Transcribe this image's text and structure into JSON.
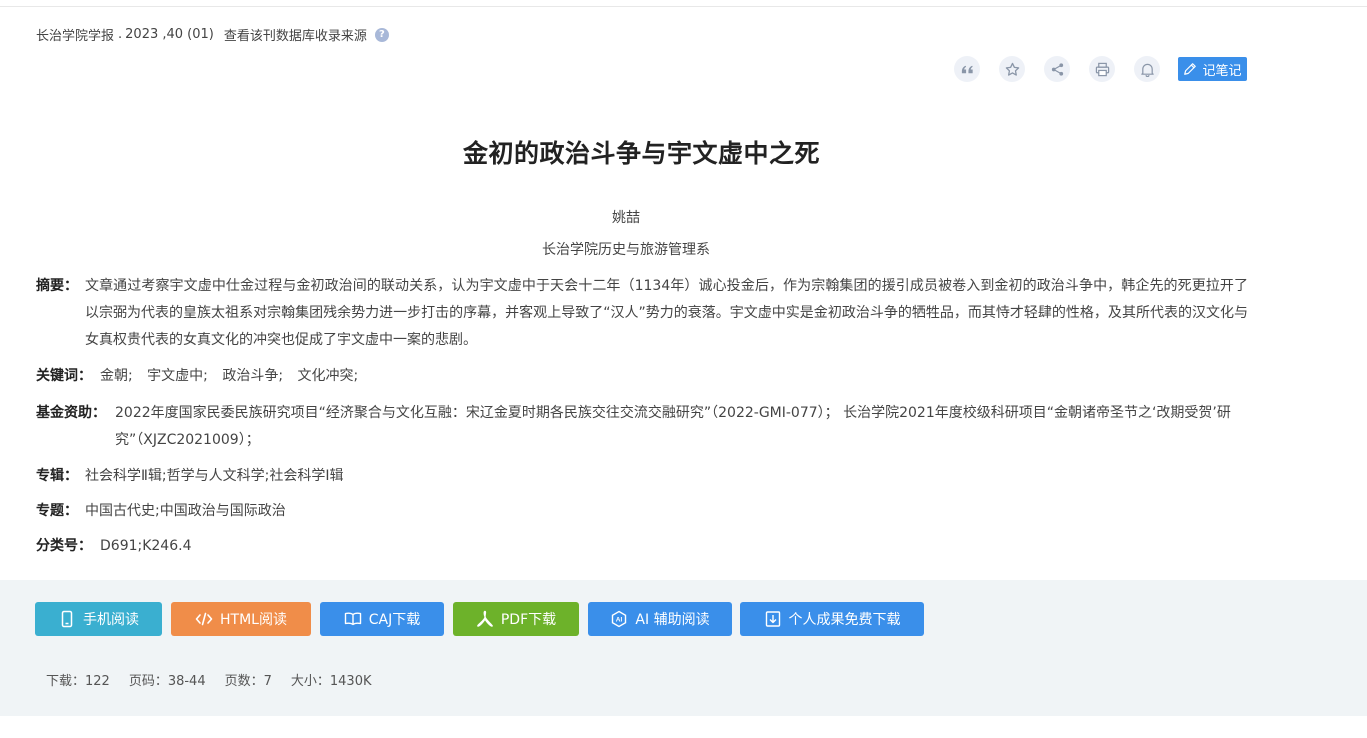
{
  "source": {
    "journal": "长治学院学报",
    "sep": ".",
    "issue": "2023 ,40 (01)",
    "db_link": "查看该刊数据库收录来源",
    "help_icon": "?"
  },
  "toolbar": {
    "icons": [
      "quote-icon",
      "star-icon",
      "share-icon",
      "print-icon",
      "bell-icon"
    ],
    "note_label": "记笔记"
  },
  "article": {
    "title": "金初的政治斗争与宇文虚中之死",
    "author": "姚喆",
    "affiliation": "长治学院历史与旅游管理系"
  },
  "meta": {
    "abstract_label": "摘要：",
    "abstract": "文章通过考察宇文虚中仕金过程与金初政治间的联动关系，认为宇文虚中于天会十二年（1134年）诚心投金后，作为宗翰集团的援引成员被卷入到金初的政治斗争中，韩企先的死更拉开了以宗弼为代表的皇族太祖系对宗翰集团残余势力进一步打击的序幕，并客观上导致了“汉人”势力的衰落。宇文虚中实是金初政治斗争的牺牲品，而其恃才轻肆的性格，及其所代表的汉文化与女真权贵代表的女真文化的冲突也促成了宇文虚中一案的悲剧。",
    "keywords_label": "关键词：",
    "keywords": [
      "金朝;",
      "宇文虚中;",
      "政治斗争;",
      "文化冲突;"
    ],
    "funds_label": "基金资助：",
    "funds": "2022年度国家民委民族研究项目“经济聚合与文化互融：宋辽金夏时期各民族交往交流交融研究”（2022-GMI-077）；  长治学院2021年度校级科研项目“金朝诸帝圣节之‘改期受贺’研究”（XJZC2021009）；",
    "zhuanji_label": "专辑：",
    "zhuanji": "社会科学Ⅱ辑;哲学与人文科学;社会科学Ⅰ辑",
    "zhuanti_label": "专题：",
    "zhuanti": "中国古代史;中国政治与国际政治",
    "clc_label": "分类号：",
    "clc": "D691;K246.4"
  },
  "actions": {
    "mobile": "手机阅读",
    "html": "HTML阅读",
    "caj": "CAJ下载",
    "pdf": "PDF下载",
    "ai": "AI 辅助阅读",
    "personal": "个人成果免费下载"
  },
  "stats": {
    "downloads": "下载：122",
    "pages_range": "页码：38-44",
    "page_count": "页数：7",
    "size": "大小：1430K"
  },
  "colors": {
    "accent_blue": "#3a8fea",
    "mobile_btn": "#3aafd0",
    "html_btn": "#f08d49",
    "pdf_btn": "#6db22a",
    "panel_bg": "#f0f4f6"
  }
}
